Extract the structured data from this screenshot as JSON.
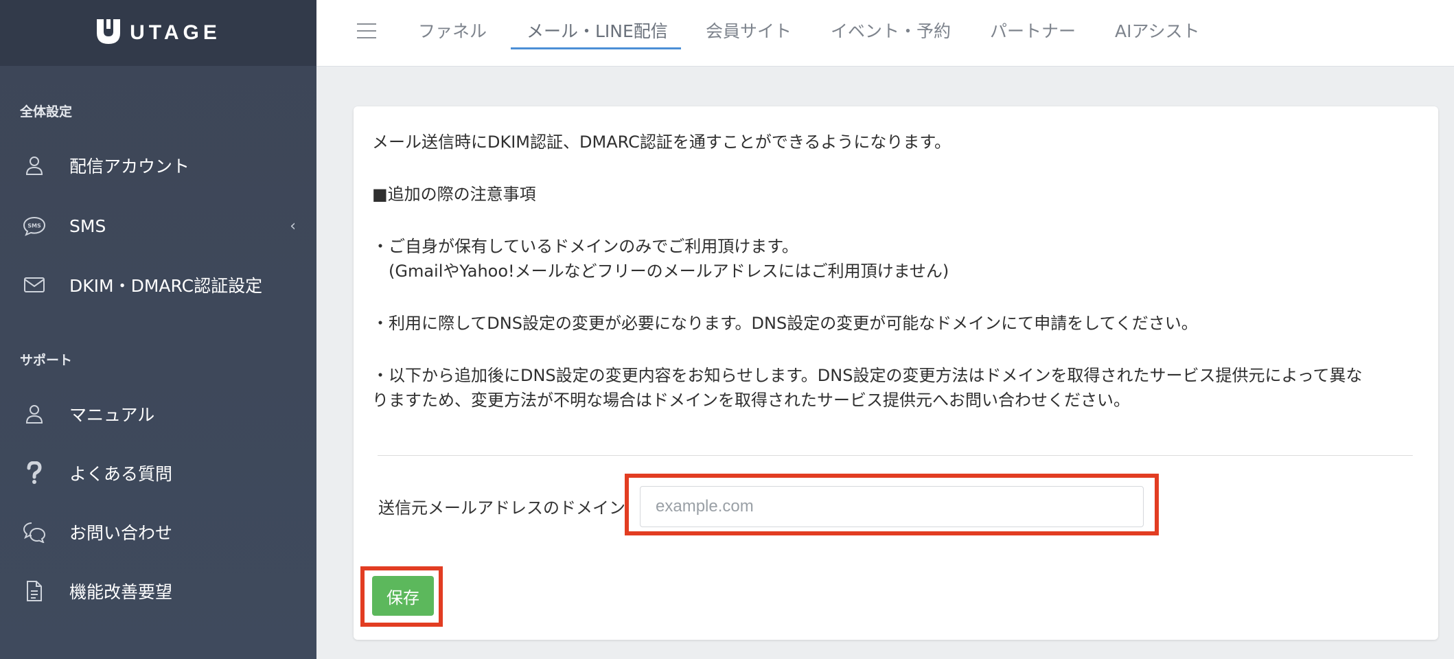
{
  "brand": {
    "name": "UTAGE"
  },
  "sidebar": {
    "sections": [
      {
        "title": "全体設定",
        "items": [
          {
            "label": "配信アカウント",
            "icon": "user-icon"
          },
          {
            "label": "SMS",
            "icon": "sms-chat-icon",
            "has_submenu": true
          },
          {
            "label": "DKIM・DMARC認証設定",
            "icon": "envelope-icon"
          }
        ]
      },
      {
        "title": "サポート",
        "items": [
          {
            "label": "マニュアル",
            "icon": "user-icon"
          },
          {
            "label": "よくある質問",
            "icon": "question-icon"
          },
          {
            "label": "お問い合わせ",
            "icon": "chat-bubbles-icon"
          },
          {
            "label": "機能改善要望",
            "icon": "document-icon"
          }
        ]
      }
    ]
  },
  "topbar": {
    "tabs": [
      {
        "label": "ファネル"
      },
      {
        "label": "メール・LINE配信",
        "active": true
      },
      {
        "label": "会員サイト"
      },
      {
        "label": "イベント・予約"
      },
      {
        "label": "パートナー"
      },
      {
        "label": "AIアシスト"
      }
    ]
  },
  "main": {
    "intro": "メール送信時にDKIM認証、DMARC認証を通すことができるようになります。",
    "notice_heading": "■追加の際の注意事項",
    "notes": [
      "・ご自身が保有しているドメインのみでご利用頂けます。",
      "　(GmailやYahoo!メールなどフリーのメールアドレスにはご利用頂けません)",
      "・利用に際してDNS設定の変更が必要になります。DNS設定の変更が可能なドメインにて申請をしてください。",
      "・以下から追加後にDNS設定の変更内容をお知らせします。DNS設定の変更方法はドメインを取得されたサービス提供元によって異な",
      "りますため、変更方法が不明な場合はドメインを取得されたサービス提供元へお問い合わせください。"
    ],
    "form": {
      "domain_label": "送信元メールアドレスのドメイン",
      "domain_placeholder": "example.com",
      "domain_value": "",
      "save_label": "保存"
    }
  },
  "colors": {
    "sidebar_bg": "#3d4657",
    "brand_bg": "#323a4a",
    "active_tab_underline": "#4c8fd6",
    "save_button": "#5cb85c",
    "highlight_border": "#e23d22"
  }
}
